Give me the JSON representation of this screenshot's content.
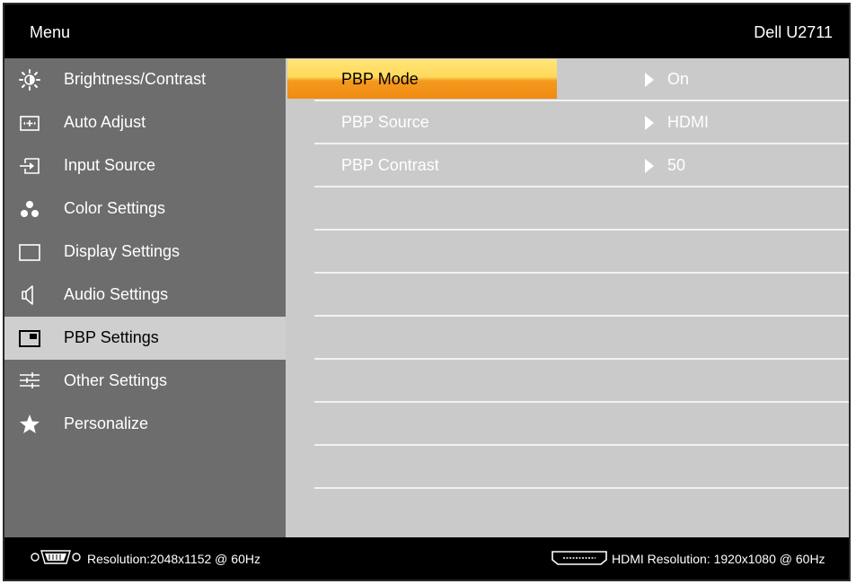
{
  "header": {
    "title": "Menu",
    "model": "Dell U2711"
  },
  "sidebar": {
    "items": [
      {
        "label": "Brightness/Contrast",
        "icon": "brightness-icon"
      },
      {
        "label": "Auto Adjust",
        "icon": "auto-adjust-icon"
      },
      {
        "label": "Input Source",
        "icon": "input-source-icon"
      },
      {
        "label": "Color Settings",
        "icon": "color-settings-icon"
      },
      {
        "label": "Display Settings",
        "icon": "display-settings-icon"
      },
      {
        "label": "Audio Settings",
        "icon": "speaker-icon"
      },
      {
        "label": "PBP Settings",
        "icon": "pbp-icon",
        "active": true
      },
      {
        "label": "Other Settings",
        "icon": "other-settings-icon"
      },
      {
        "label": "Personalize",
        "icon": "star-icon"
      }
    ]
  },
  "content": {
    "rows": [
      {
        "name": "PBP Mode",
        "value": "On",
        "selected": true
      },
      {
        "name": "PBP Source",
        "value": "HDMI"
      },
      {
        "name": "PBP Contrast",
        "value": "50"
      }
    ]
  },
  "footer": {
    "resolution": "Resolution:2048x1152 @ 60Hz",
    "hdmi_resolution": "HDMI Resolution: 1920x1080 @ 60Hz",
    "left_icon": "vga-connector-icon",
    "right_icon": "hdmi-connector-icon"
  },
  "colors": {
    "header_bg": "#000000",
    "sidebar_bg": "#6d6d6d",
    "sidebar_active_bg": "#cfcfcf",
    "content_bg": "#cacaca",
    "highlight_top": "#ffe57a",
    "highlight_bottom": "#f08a12"
  }
}
